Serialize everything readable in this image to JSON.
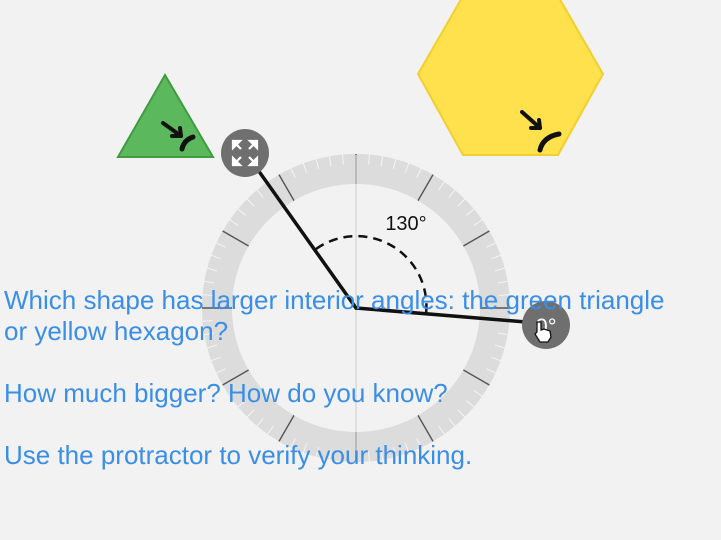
{
  "protractor": {
    "angle_label": "130°",
    "angle_degrees": 130,
    "arm_handle_label": "0°",
    "move_handle_icon": "move-arrows-icon",
    "cursor_icon": "hand-pointer-icon"
  },
  "shapes": {
    "triangle": {
      "fill": "#5cb85c",
      "stroke": "#3f9c3f",
      "rotate_icon": "rotate-arrow-icon"
    },
    "hexagon": {
      "fill": "#ffe14d",
      "stroke": "#f2cf2e",
      "rotate_icon": "rotate-arrow-icon"
    }
  },
  "prompt": {
    "line1": "Which shape has larger interior angles: the green triangle\nor yellow hexagon?",
    "line2": "How much bigger? How do you know?",
    "line3": "Use the protractor to verify your thinking."
  },
  "colors": {
    "text": "#3a8ee6",
    "background": "#f2f2f3",
    "handle": "#6f6f6f"
  }
}
